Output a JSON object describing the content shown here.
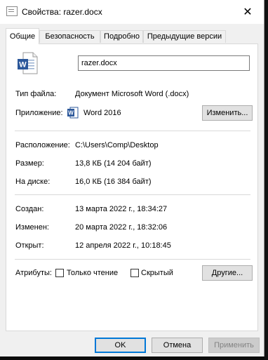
{
  "window": {
    "title": "Свойства: razer.docx",
    "close_glyph": "✕"
  },
  "tabs": [
    {
      "label": "Общие",
      "active": true
    },
    {
      "label": "Безопасность",
      "active": false
    },
    {
      "label": "Подробно",
      "active": false
    },
    {
      "label": "Предыдущие версии",
      "active": false
    }
  ],
  "general": {
    "file_name": "razer.docx",
    "file_type_label": "Тип файла:",
    "file_type_value": "Документ Microsoft Word (.docx)",
    "app_label": "Приложение:",
    "app_value": "Word 2016",
    "change_button": "Изменить...",
    "location_label": "Расположение:",
    "location_value": "C:\\Users\\Comp\\Desktop",
    "size_label": "Размер:",
    "size_value": "13,8 КБ (14 204 байт)",
    "disk_label": "На диске:",
    "disk_value": "16,0 КБ (16 384 байт)",
    "created_label": "Создан:",
    "created_value": "13 марта 2022 г., 18:34:27",
    "modified_label": "Изменен:",
    "modified_value": "20 марта 2022 г., 18:32:06",
    "accessed_label": "Открыт:",
    "accessed_value": "12 апреля 2022 г., 10:18:45",
    "attributes_label": "Атрибуты:",
    "readonly_label": "Только чтение",
    "readonly_checked": false,
    "hidden_label": "Скрытый",
    "hidden_checked": false,
    "other_button": "Другие..."
  },
  "footer": {
    "ok": "OK",
    "cancel": "Отмена",
    "apply": "Применить"
  },
  "colors": {
    "word_blue": "#2b579a",
    "focus_blue": "#0078d7"
  },
  "icons": {
    "title": "document-properties-icon",
    "file": "word-document-icon",
    "app": "word-app-icon"
  }
}
